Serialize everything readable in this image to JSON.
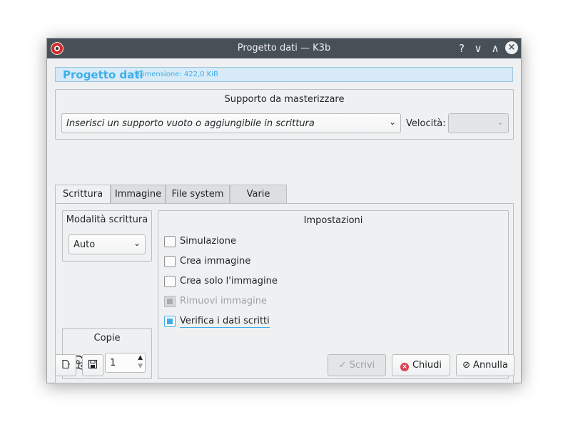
{
  "window": {
    "title": "Progetto dati — K3b",
    "help_glyph": "?",
    "minimize_glyph": "∨",
    "maximize_glyph": "∧",
    "close_glyph": "×"
  },
  "header": {
    "title": "Progetto dati",
    "size": "Dimensione: 422,0 KiB"
  },
  "medium": {
    "group_title": "Supporto da masterizzare",
    "combo_value": "Inserisci un supporto vuoto o aggiungibile in scrittura",
    "speed_label": "Velocità:",
    "speed_value": ""
  },
  "tabs": [
    {
      "label": "Scrittura",
      "active": true
    },
    {
      "label": "Immagine",
      "active": false
    },
    {
      "label": "File system",
      "active": false
    },
    {
      "label": "Varie",
      "active": false
    }
  ],
  "write_mode": {
    "group_title": "Modalità scrittura",
    "value": "Auto"
  },
  "copies": {
    "group_title": "Copie",
    "value": "1",
    "icon": "disc-copy-icon"
  },
  "settings": {
    "group_title": "Impostazioni",
    "options": [
      {
        "label": "Simulazione",
        "checked": false,
        "enabled": true
      },
      {
        "label": "Crea immagine",
        "checked": false,
        "enabled": true
      },
      {
        "label": "Crea solo l'immagine",
        "checked": false,
        "enabled": true
      },
      {
        "label": "Rimuovi immagine",
        "checked": true,
        "enabled": false
      },
      {
        "label": "Verifica i dati scritti",
        "checked": true,
        "enabled": true
      }
    ]
  },
  "buttons": {
    "scrivi": "Scrivi",
    "chiudi": "Chiudi",
    "annulla": "Annulla"
  },
  "colors": {
    "accent": "#3daee9",
    "titlebar": "#475057",
    "close_red": "#da4453"
  }
}
